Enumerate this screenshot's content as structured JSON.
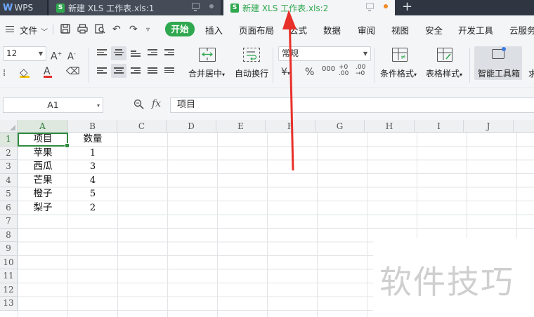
{
  "tabs": {
    "app_label": "WPS",
    "doc1_label": "新建 XLS 工作表.xls:1",
    "doc2_label": "新建 XLS 工作表.xls:2",
    "file_icon_letter": "S"
  },
  "menu": {
    "file": "文件",
    "start": "开始",
    "items": [
      "插入",
      "页面布局",
      "公式",
      "数据",
      "审阅",
      "视图",
      "安全",
      "开发工具",
      "云服务"
    ]
  },
  "ribbon": {
    "font_size": "12",
    "number_format": "常规",
    "merge_center": "合并居中",
    "wrap_text": "自动换行",
    "conditional_format": "条件格式",
    "table_style": "表格样式",
    "smart_toolbox": "智能工具箱",
    "truncated": "求"
  },
  "formula_bar": {
    "cell_ref": "A1",
    "fx": "fx",
    "content": "项目"
  },
  "columns": [
    "A",
    "B",
    "C",
    "D",
    "E",
    "F",
    "G",
    "H",
    "I",
    "J"
  ],
  "rows": [
    "1",
    "2",
    "3",
    "4",
    "5",
    "6",
    "7",
    "8",
    "9",
    "10",
    "11",
    "12",
    "13"
  ],
  "table": {
    "headers": [
      "项目",
      "数量"
    ],
    "rows": [
      [
        "苹果",
        "1"
      ],
      [
        "西瓜",
        "3"
      ],
      [
        "芒果",
        "4"
      ],
      [
        "橙子",
        "5"
      ],
      [
        "梨子",
        "2"
      ]
    ]
  },
  "watermark": "软件技巧",
  "colors": {
    "accent_green": "#2fa84f",
    "tab_dark": "#2f3541",
    "arrow_red": "#e8302a"
  }
}
